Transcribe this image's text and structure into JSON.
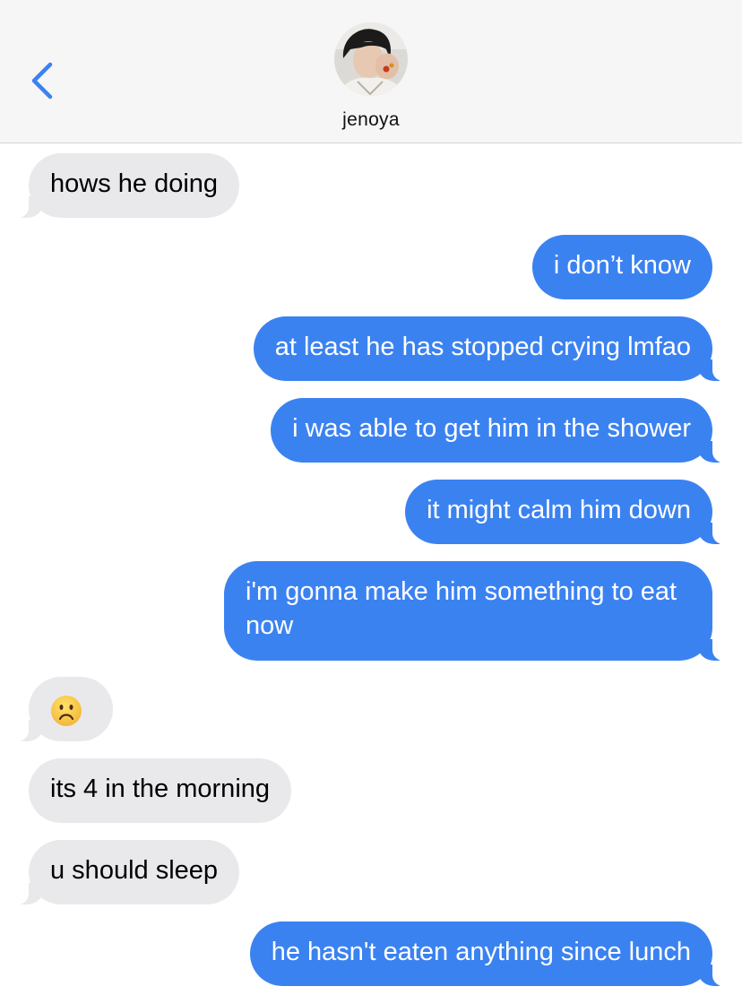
{
  "header": {
    "contact_name": "jenoya",
    "back_icon": "chevron-left-icon",
    "accent_color": "#3b82f1"
  },
  "messages": [
    {
      "direction": "incoming",
      "text": "hows he doing"
    },
    {
      "direction": "outgoing",
      "text": "i don’t know"
    },
    {
      "direction": "outgoing",
      "text": "at least he has stopped crying lmfao"
    },
    {
      "direction": "outgoing",
      "text": "i was able to get him in the shower"
    },
    {
      "direction": "outgoing",
      "text": "it might calm him down"
    },
    {
      "direction": "outgoing",
      "text": "i'm gonna make him something to eat now"
    },
    {
      "direction": "incoming",
      "text": "",
      "icon": "frowning-face-emoji"
    },
    {
      "direction": "incoming",
      "text": "its 4 in the morning"
    },
    {
      "direction": "incoming",
      "text": "u should sleep"
    },
    {
      "direction": "outgoing",
      "text": "he hasn't eaten anything since lunch"
    }
  ],
  "colors": {
    "incoming_bubble": "#e9e9eb",
    "outgoing_bubble": "#3b82f1",
    "header_background": "#f6f6f6"
  }
}
